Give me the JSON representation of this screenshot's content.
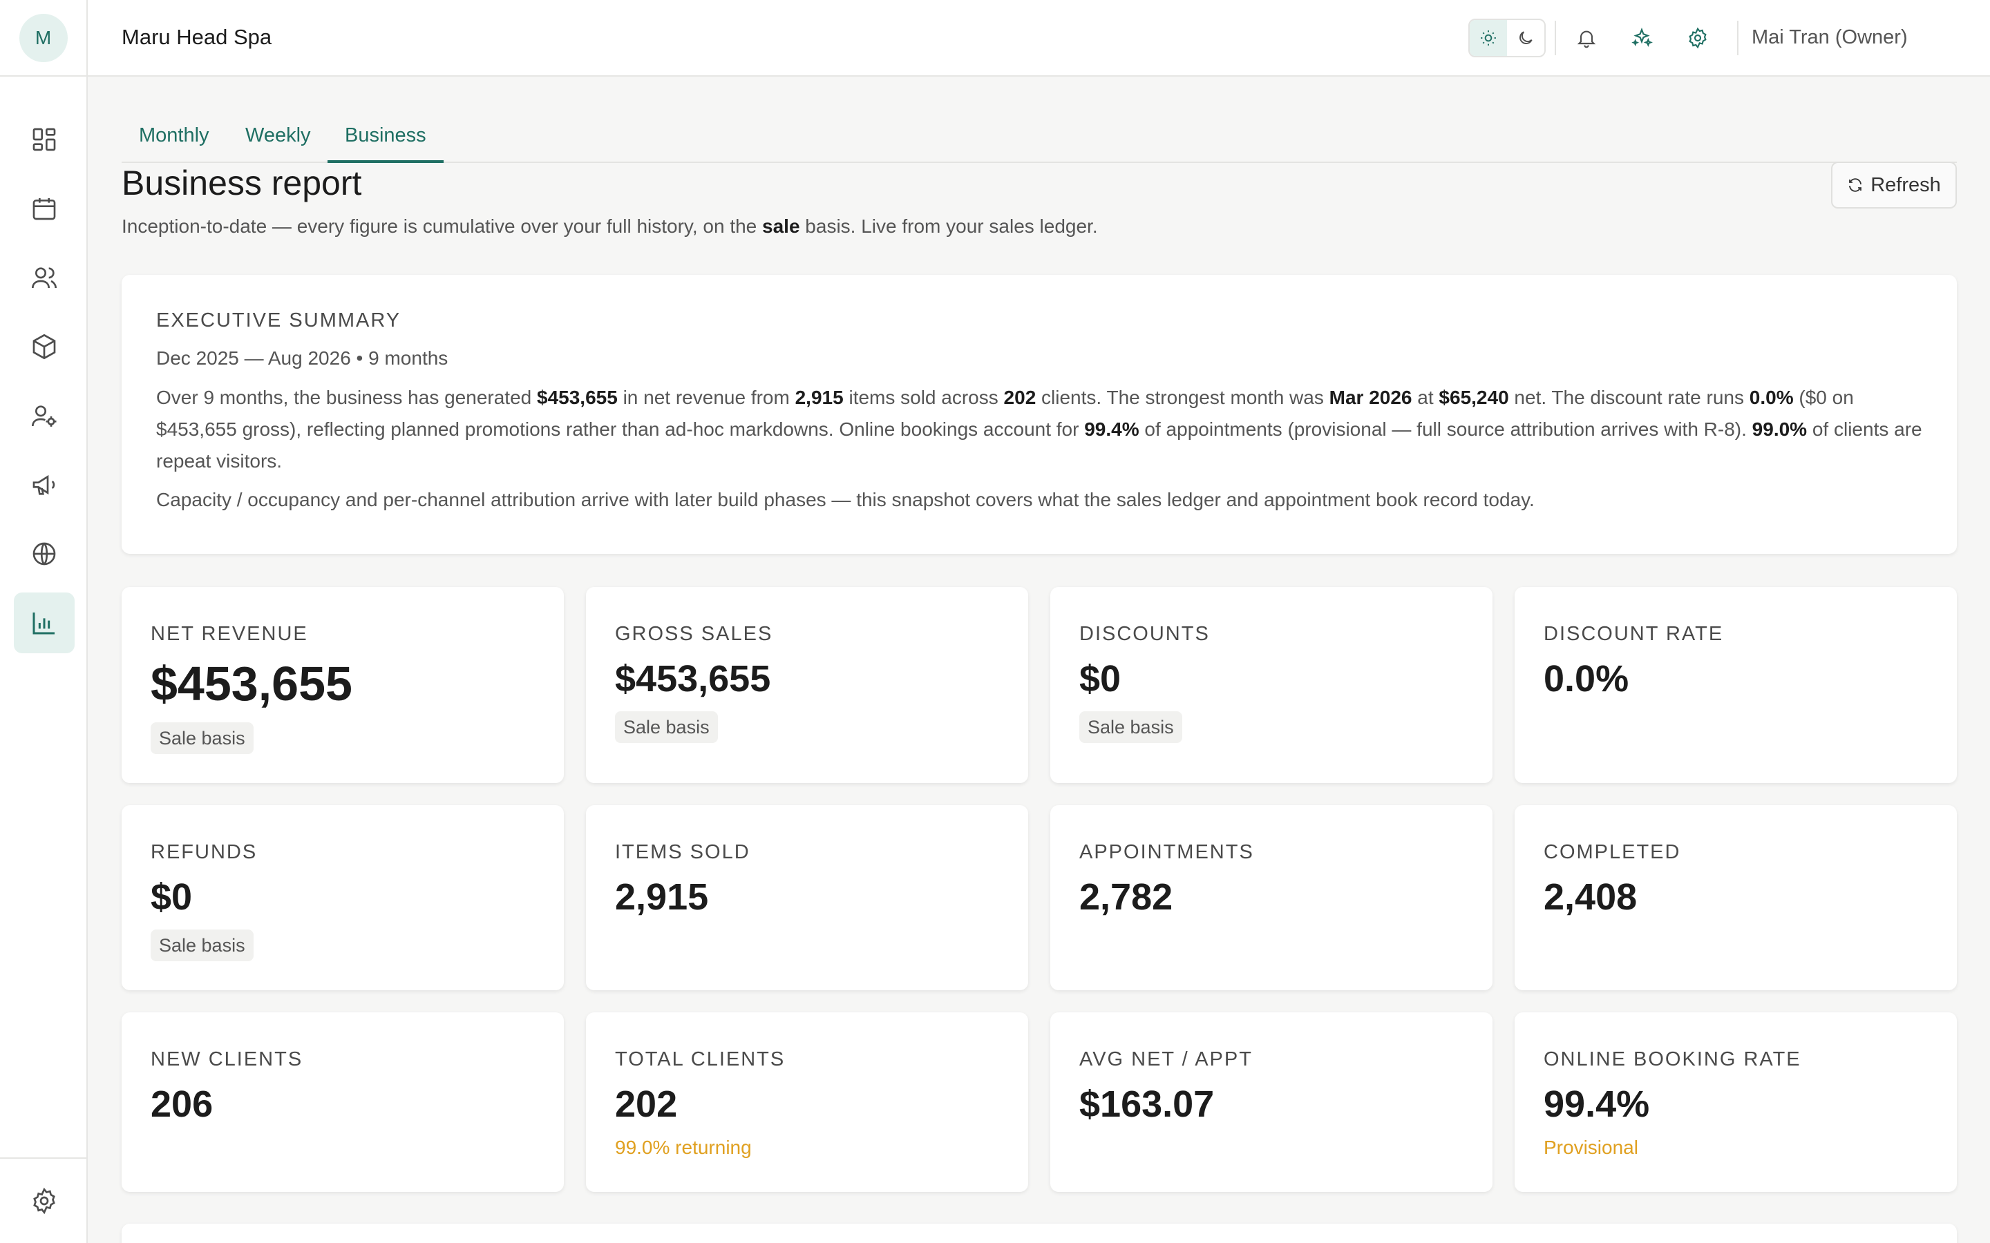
{
  "app": {
    "initial": "M",
    "title": "Maru Head Spa"
  },
  "header": {
    "user": "Mai Tran (Owner)"
  },
  "tabs": [
    {
      "label": "Monthly",
      "active": false
    },
    {
      "label": "Weekly",
      "active": false
    },
    {
      "label": "Business",
      "active": true
    }
  ],
  "page": {
    "title": "Business report",
    "subtitle_pre": "Inception-to-date — every figure is cumulative over your full history, on the ",
    "subtitle_bold": "sale",
    "subtitle_post": " basis. Live from your sales ledger.",
    "refresh_label": "Refresh"
  },
  "summary": {
    "eyebrow": "EXECUTIVE SUMMARY",
    "period": "Dec 2025 — Aug 2026 • 9 months",
    "p1": [
      "Over 9 months, the business has generated ",
      "$453,655",
      " in net revenue from ",
      "2,915",
      " items sold across ",
      "202",
      " clients. The strongest month was ",
      "Mar 2026",
      " at ",
      "$65,240",
      " net. The discount rate runs ",
      "0.0%",
      " ($0 on $453,655 gross), reflecting planned promotions rather than ad-hoc markdowns. Online bookings account for ",
      "99.4%",
      " of appointments (provisional — full source attribution arrives with R-8). ",
      "99.0%",
      " of clients are repeat visitors."
    ],
    "p2": "Capacity / occupancy and per-channel attribution arrive with later build phases — this snapshot covers what the sales ledger and appointment book record today."
  },
  "metrics": [
    {
      "label": "NET REVENUE",
      "value": "$453,655",
      "chip": "Sale basis"
    },
    {
      "label": "GROSS SALES",
      "value": "$453,655",
      "chip": "Sale basis"
    },
    {
      "label": "DISCOUNTS",
      "value": "$0",
      "chip": "Sale basis"
    },
    {
      "label": "DISCOUNT RATE",
      "value": "0.0%"
    },
    {
      "label": "REFUNDS",
      "value": "$0",
      "chip": "Sale basis"
    },
    {
      "label": "ITEMS SOLD",
      "value": "2,915"
    },
    {
      "label": "APPOINTMENTS",
      "value": "2,782"
    },
    {
      "label": "COMPLETED",
      "value": "2,408"
    },
    {
      "label": "NEW CLIENTS",
      "value": "206"
    },
    {
      "label": "TOTAL CLIENTS",
      "value": "202",
      "note": "99.0% returning"
    },
    {
      "label": "AVG NET / APPT",
      "value": "$163.07"
    },
    {
      "label": "ONLINE BOOKING RATE",
      "value": "99.4%",
      "note": "Provisional"
    }
  ],
  "icons": {
    "sidebar": [
      "dashboard-icon",
      "calendar-icon",
      "clients-icon",
      "products-icon",
      "staff-icon",
      "marketing-icon",
      "web-icon",
      "reports-icon",
      "settings-icon"
    ],
    "header": [
      "sun-icon",
      "moon-icon",
      "bell-icon",
      "sparkles-icon",
      "settings-icon",
      "logout-icon"
    ]
  },
  "colors": {
    "accent": "#1f6f63",
    "accent_bg": "#e4f1ee",
    "warning": "#e0a020"
  }
}
